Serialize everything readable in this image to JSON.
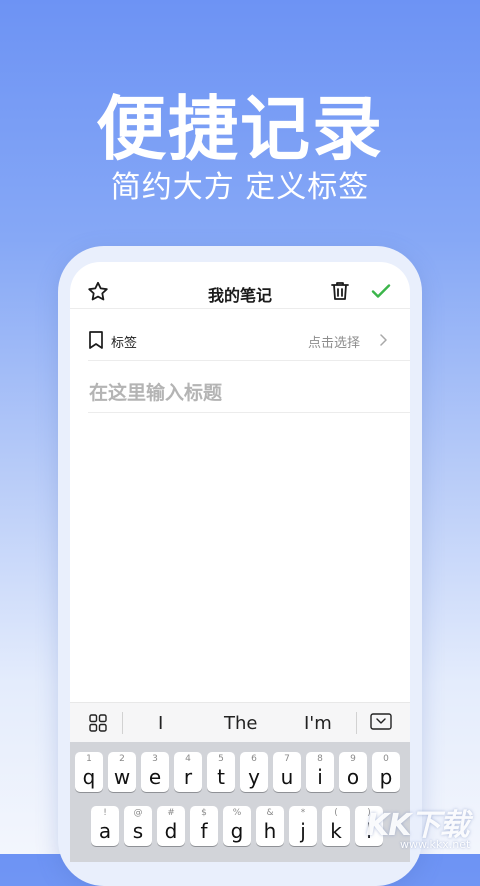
{
  "hero": {
    "title": "便捷记录",
    "subtitle": "简约大方 定义标签"
  },
  "note": {
    "header_title": "我的笔记",
    "tag_label": "标签",
    "tag_action": "点击选择",
    "title_placeholder": "在这里输入标题"
  },
  "suggestions": [
    "I",
    "The",
    "I'm"
  ],
  "keyboard": {
    "row1": [
      {
        "hint": "1",
        "key": "q"
      },
      {
        "hint": "2",
        "key": "w"
      },
      {
        "hint": "3",
        "key": "e"
      },
      {
        "hint": "4",
        "key": "r"
      },
      {
        "hint": "5",
        "key": "t"
      },
      {
        "hint": "6",
        "key": "y"
      },
      {
        "hint": "7",
        "key": "u"
      },
      {
        "hint": "8",
        "key": "i"
      },
      {
        "hint": "9",
        "key": "o"
      },
      {
        "hint": "0",
        "key": "p"
      }
    ],
    "row2": [
      {
        "hint": "!",
        "key": "a"
      },
      {
        "hint": "@",
        "key": "s"
      },
      {
        "hint": "#",
        "key": "d"
      },
      {
        "hint": "$",
        "key": "f"
      },
      {
        "hint": "%",
        "key": "g"
      },
      {
        "hint": "&",
        "key": "h"
      },
      {
        "hint": "*",
        "key": "j"
      },
      {
        "hint": "(",
        "key": "k"
      },
      {
        "hint": ")",
        "key": "l"
      }
    ]
  },
  "watermark": {
    "logo_text": "KK下载",
    "url": "www.kkx.net"
  },
  "colors": {
    "accent_check": "#3bb54a",
    "background_top": "#6d93f4"
  },
  "icons": {
    "favorite": "star-icon",
    "delete": "trash-icon",
    "save": "check-icon",
    "tag": "bookmark-icon",
    "chevron": "chevron-right-icon",
    "toolbar": "grid-icon",
    "hide_keyboard": "keyboard-hide-icon"
  }
}
